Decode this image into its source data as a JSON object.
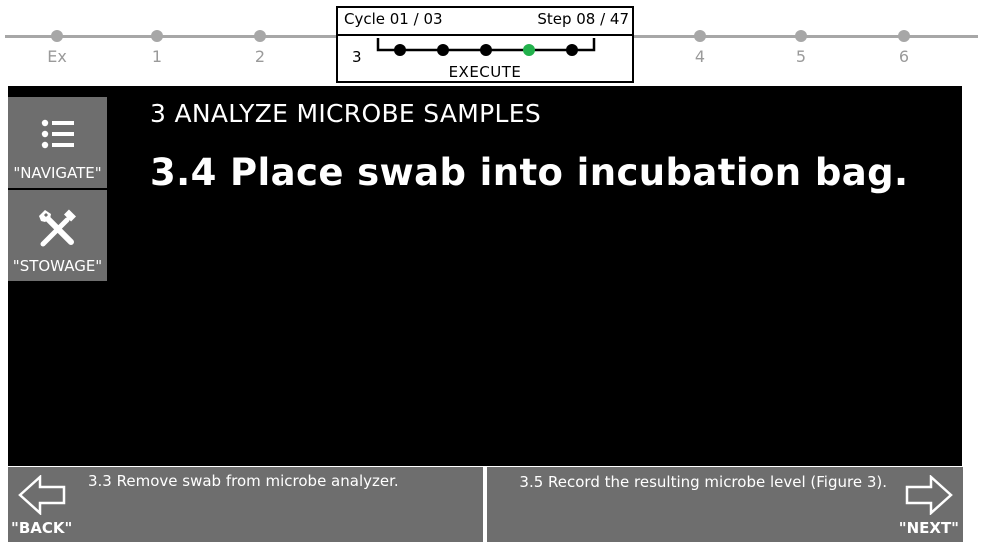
{
  "timeline": {
    "nodes": [
      {
        "label": "Ex"
      },
      {
        "label": "1"
      },
      {
        "label": "2"
      },
      {
        "label": "4"
      },
      {
        "label": "5"
      },
      {
        "label": "6"
      }
    ]
  },
  "status": {
    "cycle": "Cycle 01 / 03",
    "step": "Step 08 / 47",
    "section": "3",
    "phase": "EXECUTE",
    "substeps_total": 5,
    "active_substep": 4,
    "active_color": "#22b14c"
  },
  "sidebar": {
    "navigate_label": "\"NAVIGATE\"",
    "navigate_icon": "list-icon",
    "stowage_label": "\"STOWAGE\"",
    "stowage_icon": "tools-icon"
  },
  "main": {
    "section_title": "3 ANALYZE MICROBE SAMPLES",
    "step_text": "3.4 Place swab into incubation bag."
  },
  "nav": {
    "back_label": "\"BACK\"",
    "back_desc": "3.3 Remove swab from microbe analyzer.",
    "next_label": "\"NEXT\"",
    "next_desc": "3.5 Record the resulting microbe level (Figure 3)."
  }
}
